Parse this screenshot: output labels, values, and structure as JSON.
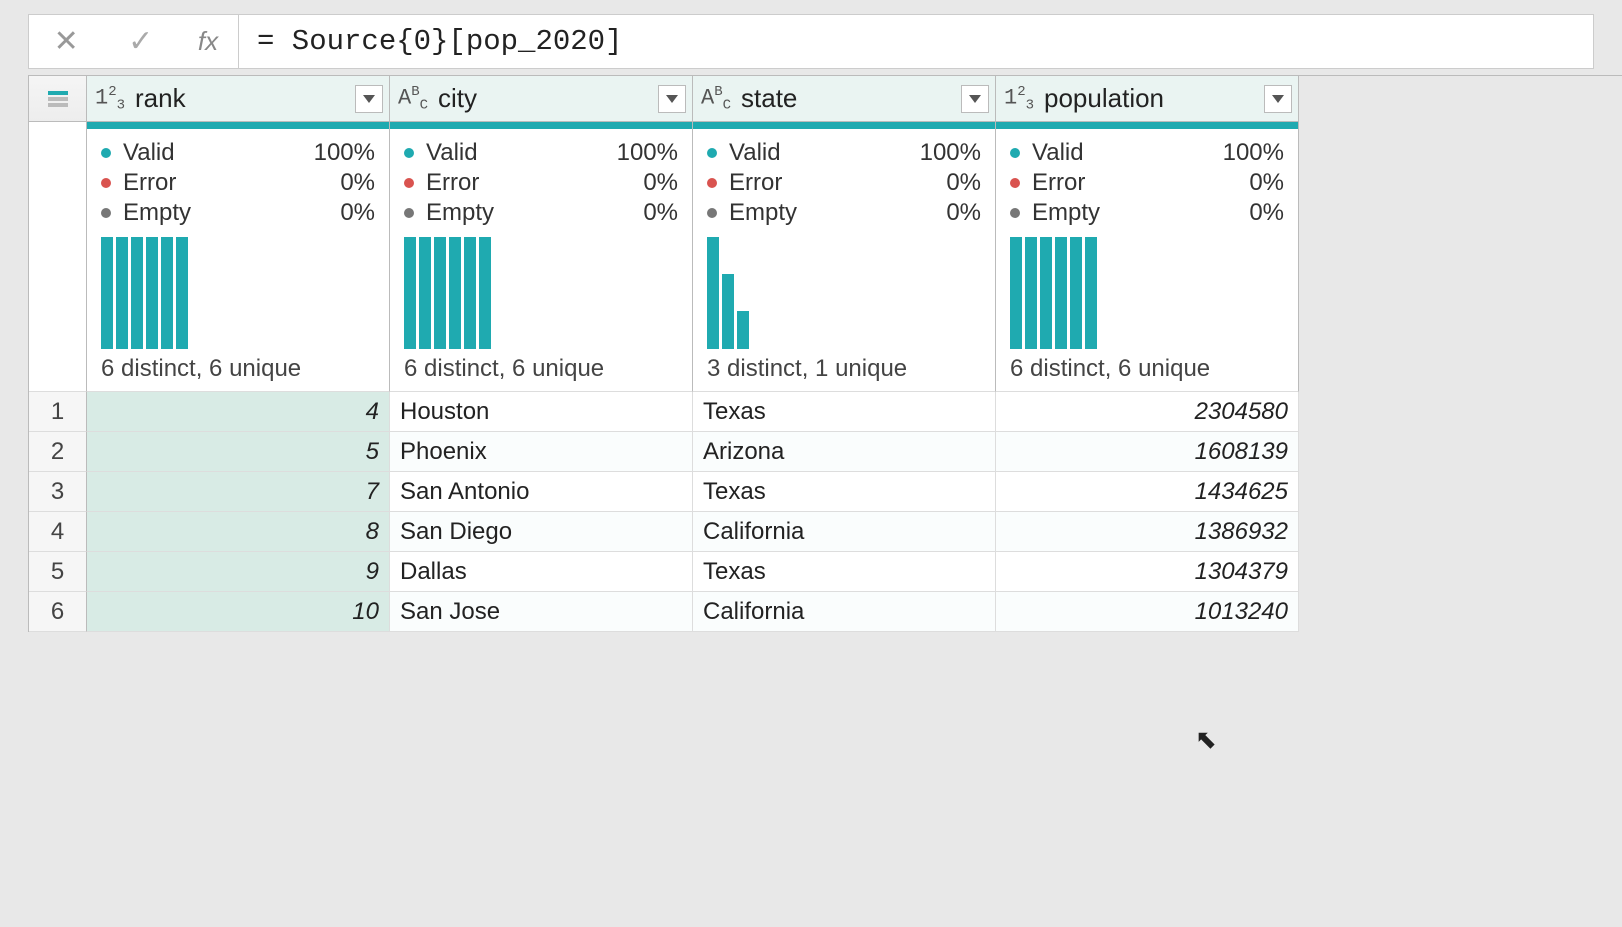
{
  "formula": "= Source{0}[pop_2020]",
  "fx_label": "fx",
  "columns": [
    {
      "name": "rank",
      "type": "number",
      "valid": "100%",
      "error": "0%",
      "empty": "0%",
      "distinct": "6 distinct, 6 unique",
      "bars": [
        100,
        100,
        100,
        100,
        100,
        100
      ]
    },
    {
      "name": "city",
      "type": "text",
      "valid": "100%",
      "error": "0%",
      "empty": "0%",
      "distinct": "6 distinct, 6 unique",
      "bars": [
        100,
        100,
        100,
        100,
        100,
        100
      ]
    },
    {
      "name": "state",
      "type": "text",
      "valid": "100%",
      "error": "0%",
      "empty": "0%",
      "distinct": "3 distinct, 1 unique",
      "bars": [
        100,
        67,
        34
      ]
    },
    {
      "name": "population",
      "type": "number",
      "valid": "100%",
      "error": "0%",
      "empty": "0%",
      "distinct": "6 distinct, 6 unique",
      "bars": [
        100,
        100,
        100,
        100,
        100,
        100
      ]
    }
  ],
  "labels": {
    "valid": "Valid",
    "error": "Error",
    "empty": "Empty"
  },
  "rows": [
    {
      "n": "1",
      "rank": "4",
      "city": "Houston",
      "state": "Texas",
      "population": "2304580"
    },
    {
      "n": "2",
      "rank": "5",
      "city": "Phoenix",
      "state": "Arizona",
      "population": "1608139"
    },
    {
      "n": "3",
      "rank": "7",
      "city": "San Antonio",
      "state": "Texas",
      "population": "1434625"
    },
    {
      "n": "4",
      "rank": "8",
      "city": "San Diego",
      "state": "California",
      "population": "1386932"
    },
    {
      "n": "5",
      "rank": "9",
      "city": "Dallas",
      "state": "Texas",
      "population": "1304379"
    },
    {
      "n": "6",
      "rank": "10",
      "city": "San Jose",
      "state": "California",
      "population": "1013240"
    }
  ],
  "selected_column": 0
}
